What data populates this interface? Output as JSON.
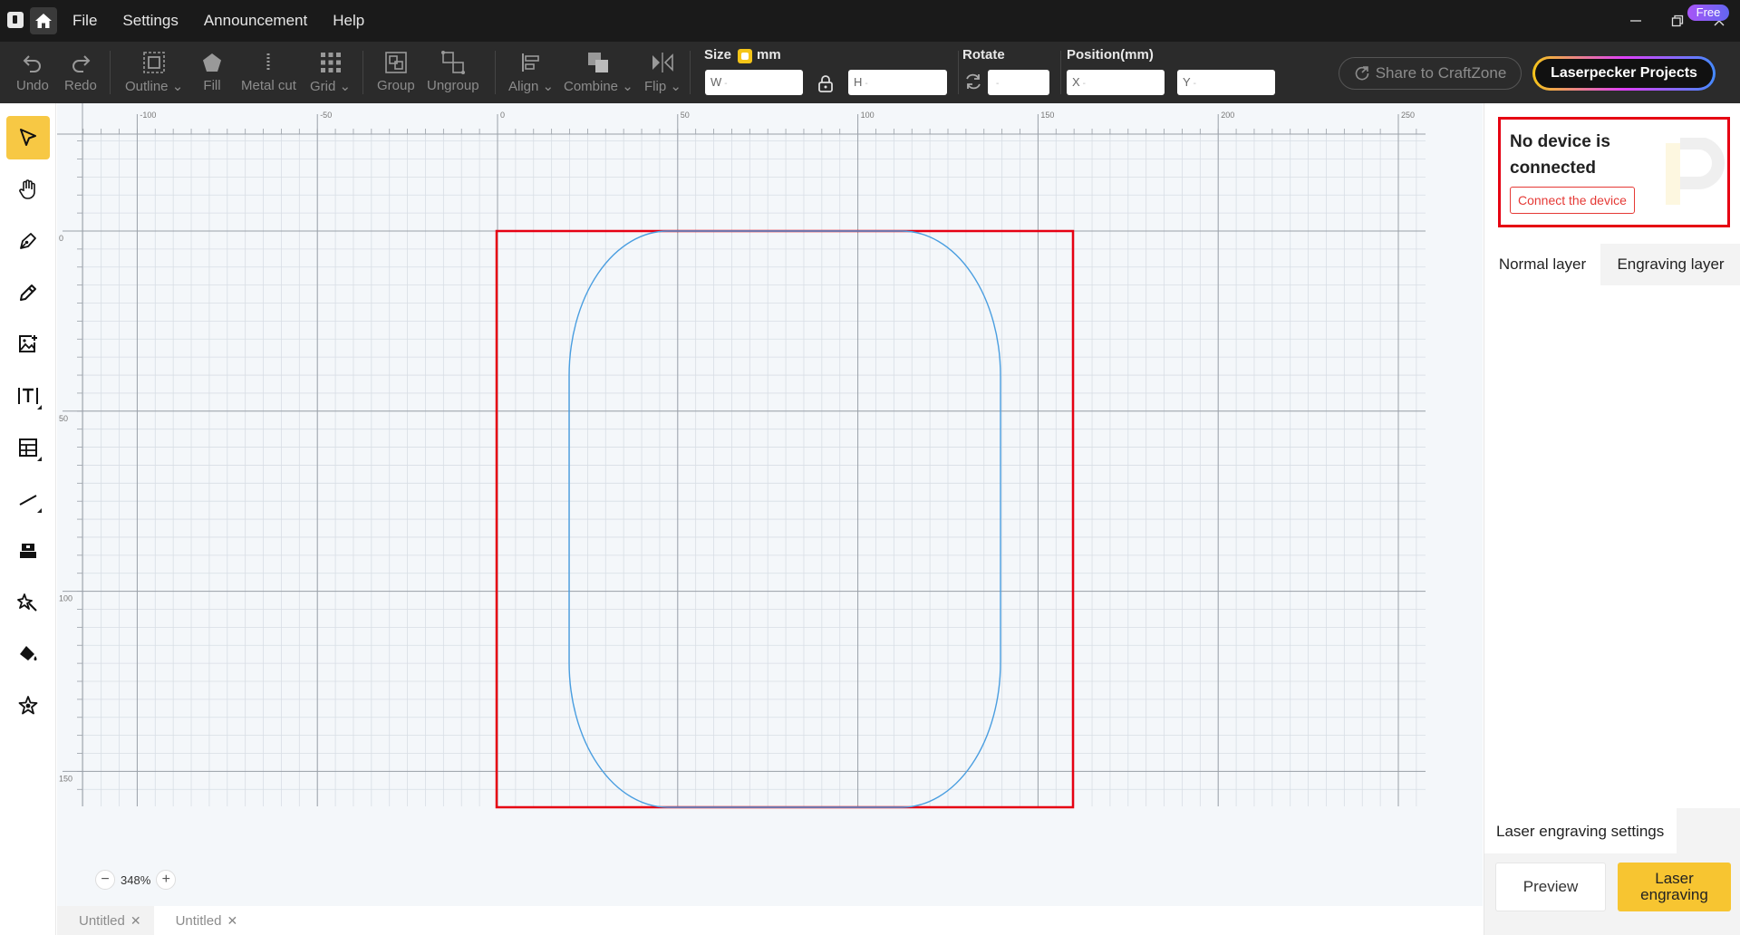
{
  "titlebar": {
    "menu": [
      "File",
      "Settings",
      "Announcement",
      "Help"
    ]
  },
  "toolbar": {
    "undo": "Undo",
    "redo": "Redo",
    "outline": "Outline",
    "fill": "Fill",
    "metal_cut": "Metal cut",
    "grid": "Grid",
    "group": "Group",
    "ungroup": "Ungroup",
    "align": "Align",
    "combine": "Combine",
    "flip": "Flip",
    "size_label": "Size",
    "unit": "mm",
    "width_prefix": "W",
    "height_prefix": "H",
    "rotate_label": "Rotate",
    "position_label": "Position(mm)",
    "x_prefix": "X",
    "y_prefix": "Y",
    "empty_value": "-",
    "share": "Share to CraftZone",
    "projects": "Laserpecker Projects",
    "free_badge": "Free"
  },
  "sidebar": {
    "tools": [
      "select-tool",
      "hand-tool",
      "pen-tool",
      "pencil-tool",
      "image-tool",
      "text-tool",
      "table-tool",
      "line-tool",
      "shape-tool",
      "magic-tool",
      "fill-bucket-tool",
      "material-tool"
    ]
  },
  "canvas": {
    "ruler_top": [
      "-100",
      "-50",
      "0",
      "50",
      "100",
      "150",
      "200",
      "250"
    ],
    "ruler_left": [
      "0",
      "50",
      "100",
      "150"
    ],
    "zoom": "348%",
    "selection_color": "#e60012",
    "shape_color": "#4a9ee0"
  },
  "doc_tabs": [
    "Untitled",
    "Untitled"
  ],
  "right_panel": {
    "device_message": "No device is connected",
    "connect_button": "Connect the device",
    "layer_tabs": [
      "Normal layer",
      "Engraving layer"
    ],
    "settings_tab": "Laser engraving settings",
    "preview_button": "Preview",
    "engrave_button": "Laser engraving"
  },
  "colors": {
    "accent": "#f7c531",
    "toolbar_bg": "#2b2b2b",
    "titlebar_bg": "#1a1a1a",
    "alert": "#e60012"
  }
}
